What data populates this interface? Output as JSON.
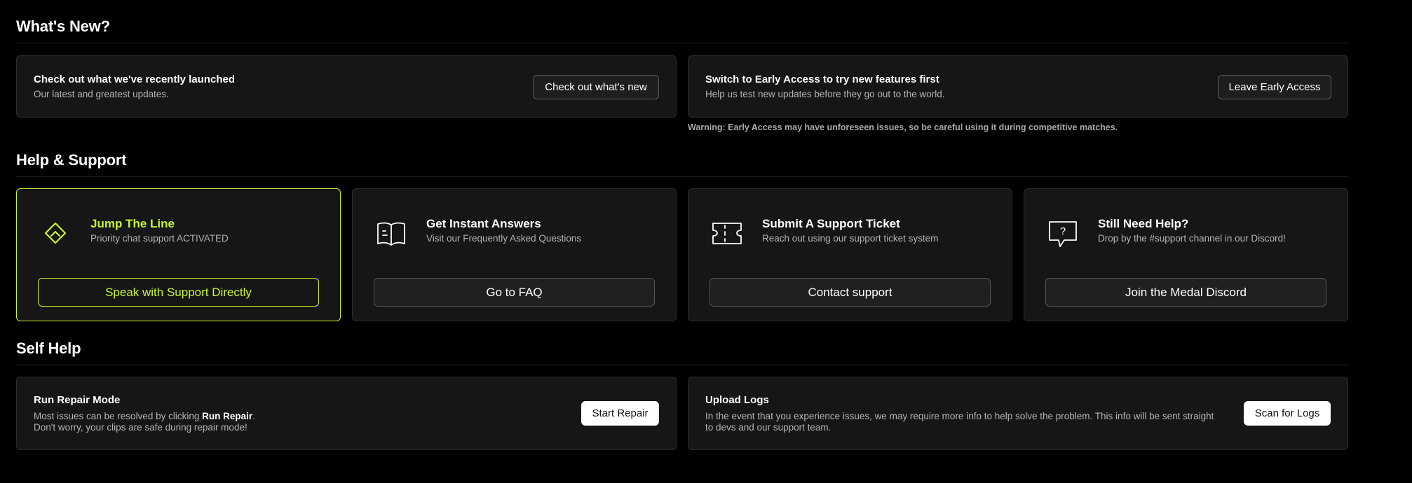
{
  "whats_new": {
    "heading": "What's New?",
    "launched": {
      "title": "Check out what we've recently launched",
      "desc": "Our latest and greatest updates.",
      "button": "Check out what's new"
    },
    "early_access": {
      "title": "Switch to Early Access to try new features first",
      "desc": "Help us test new updates before they go out to the world.",
      "button": "Leave Early Access",
      "warning": "Warning: Early Access may have unforeseen issues, so be careful using it during competitive matches."
    }
  },
  "help_support": {
    "heading": "Help & Support",
    "cards": [
      {
        "icon": "priority-diamond-icon",
        "title": "Jump The Line",
        "desc": "Priority chat support ACTIVATED",
        "button": "Speak with Support Directly"
      },
      {
        "icon": "book-icon",
        "title": "Get Instant Answers",
        "desc": "Visit our Frequently Asked Questions",
        "button": "Go to FAQ"
      },
      {
        "icon": "ticket-icon",
        "title": "Submit A Support Ticket",
        "desc": "Reach out using our support ticket system",
        "button": "Contact support"
      },
      {
        "icon": "question-bubble-icon",
        "title": "Still Need Help?",
        "desc": "Drop by the #support channel in our Discord!",
        "button": "Join the Medal Discord"
      }
    ]
  },
  "self_help": {
    "heading": "Self Help",
    "repair": {
      "title": "Run Repair Mode",
      "desc_prefix": "Most issues can be resolved by clicking ",
      "desc_bold": "Run Repair",
      "desc_suffix": ".",
      "desc_line2": "Don't worry, your clips are safe during repair mode!",
      "button": "Start Repair"
    },
    "logs": {
      "title": "Upload Logs",
      "desc_line1": "In the event that you experience issues, we may require more info to help solve the problem. This info will be sent straight",
      "desc_line2": "to devs and our support team.",
      "button": "Scan for Logs"
    }
  },
  "colors": {
    "accent": "#c6f432",
    "card_bg": "#161616",
    "border": "#2c2c2c"
  }
}
